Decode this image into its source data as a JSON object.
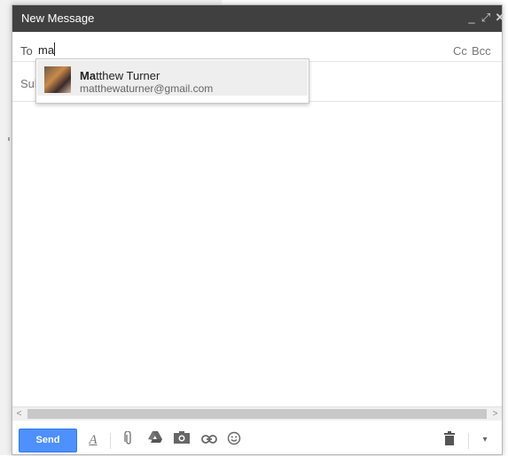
{
  "window": {
    "title": "New Message"
  },
  "titlebar_icons": {
    "minimize": "_",
    "expand": "⤢",
    "close": "✕"
  },
  "to_row": {
    "label": "To",
    "value": "ma",
    "cc_label": "Cc",
    "bcc_label": "Bcc"
  },
  "subject": {
    "placeholder": "Subject"
  },
  "autocomplete": {
    "name_match": "Ma",
    "name_rest": "tthew Turner",
    "email": "matthewaturner@gmail.com"
  },
  "toolbar": {
    "send_label": "Send",
    "icons": [
      "formatting-icon",
      "attach-icon",
      "drive-icon",
      "photo-icon",
      "link-icon",
      "emoji-icon",
      "trash-icon",
      "more-options-icon"
    ]
  },
  "colors": {
    "titlebar_bg": "#404040",
    "send_bg": "#4d90fe"
  }
}
